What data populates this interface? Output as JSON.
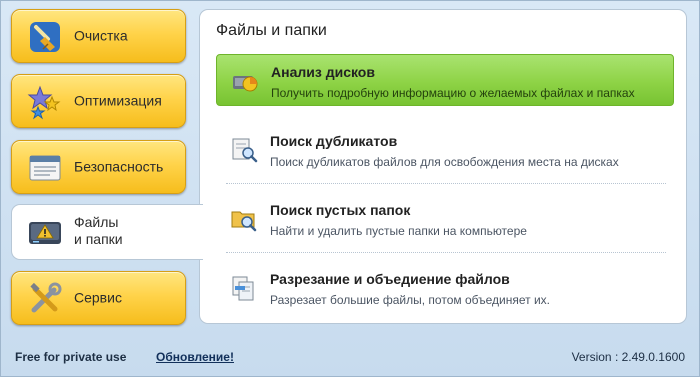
{
  "nav": {
    "items": [
      {
        "label": "Очистка",
        "icon": "broom-icon"
      },
      {
        "label": "Оптимизация",
        "icon": "stars-icon"
      },
      {
        "label": "Безопасность",
        "icon": "document-shield-icon"
      },
      {
        "label": "Файлы и папки",
        "label_line1": "Файлы",
        "label_line2": "и папки",
        "icon": "drive-warning-icon",
        "active": true
      },
      {
        "label": "Сервис",
        "icon": "tools-icon"
      }
    ]
  },
  "panel": {
    "title": "Файлы и папки",
    "items": [
      {
        "title": "Анализ дисков",
        "description": "Получить подробную информацию о желаемых файлах и папках",
        "icon": "disk-pie-icon",
        "selected": true
      },
      {
        "title": "Поиск дубликатов",
        "description": "Поиск дубликатов файлов для освобождения места на дисках",
        "icon": "document-search-icon"
      },
      {
        "title": "Поиск пустых папок",
        "description": "Найти и удалить пустые папки на компьютере",
        "icon": "folder-search-icon"
      },
      {
        "title": "Разрезание и объедиение файлов",
        "description": "Разрезает большие файлы, потом объединяет их.",
        "icon": "file-split-icon"
      }
    ]
  },
  "footer": {
    "license": "Free for private use",
    "update_link": "Обновление!",
    "version": "Version : 2.49.0.1600"
  },
  "colors": {
    "nav_button": "#ffd34a",
    "selected_item": "#8ed346",
    "background": "#c9dcef"
  }
}
